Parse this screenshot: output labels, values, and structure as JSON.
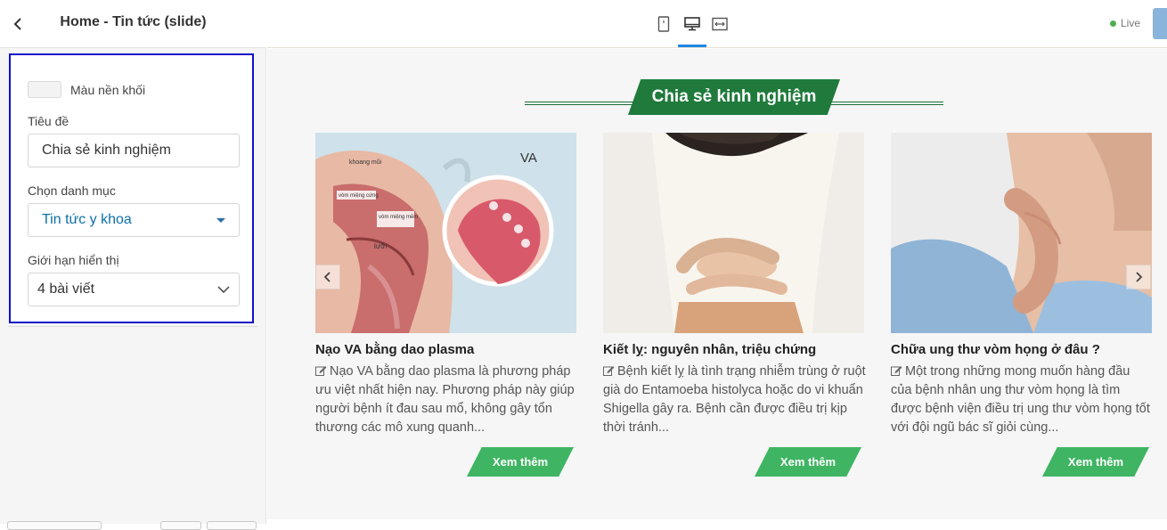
{
  "sidebar": {
    "title": "Home - Tin tức (slide)",
    "color_label": "Màu nền khối",
    "title_label": "Tiêu đề",
    "title_value": "Chia sẻ kinh nghiệm",
    "category_label": "Chọn danh mục",
    "category_value": "Tin tức y khoa",
    "limit_label": "Giới hạn hiển thị",
    "limit_value": "4 bài viết"
  },
  "toolbar": {
    "devices": [
      "mobile-icon",
      "desktop-icon",
      "fullwidth-icon"
    ],
    "active_device": "desktop",
    "live_label": "Live",
    "live_color": "#4caf50",
    "accent": "#1e88e5"
  },
  "section": {
    "heading": "Chia sẻ kinh nghiệm",
    "heading_color": "#1f7a3c",
    "button_color": "#3fb563",
    "cards": [
      {
        "title": "Nạo VA bằng dao plasma",
        "desc": "Nạo VA bằng dao plasma là phương pháp ưu việt nhất hiện nay. Phương pháp này giúp người bệnh ít đau sau mổ, không gây tổn thương các mô xung quanh...",
        "more": "Xem thêm",
        "img_labels": {
          "va": "VA",
          "a": "khoang mũi",
          "b": "vòm miệng cứng",
          "c": "vòm miệng mềm",
          "d": "lưỡi"
        }
      },
      {
        "title": "Kiết lỵ: nguyên nhân, triệu chứng",
        "desc": "Bệnh kiết lỵ là tình trạng nhiễm trùng ở ruột già do Entamoeba histolyca hoặc do vi khuẩn Shigella gây ra. Bệnh cần được điều trị kịp thời tránh...",
        "more": "Xem thêm"
      },
      {
        "title": "Chữa ung thư vòm họng ở đâu ?",
        "desc": "Một trong những mong muốn hàng đầu của bệnh nhân ung thư vòm họng là tìm được bệnh viện điều trị ung thư vòm họng tốt với đội ngũ bác sĩ giỏi cùng...",
        "more": "Xem thêm"
      }
    ]
  }
}
